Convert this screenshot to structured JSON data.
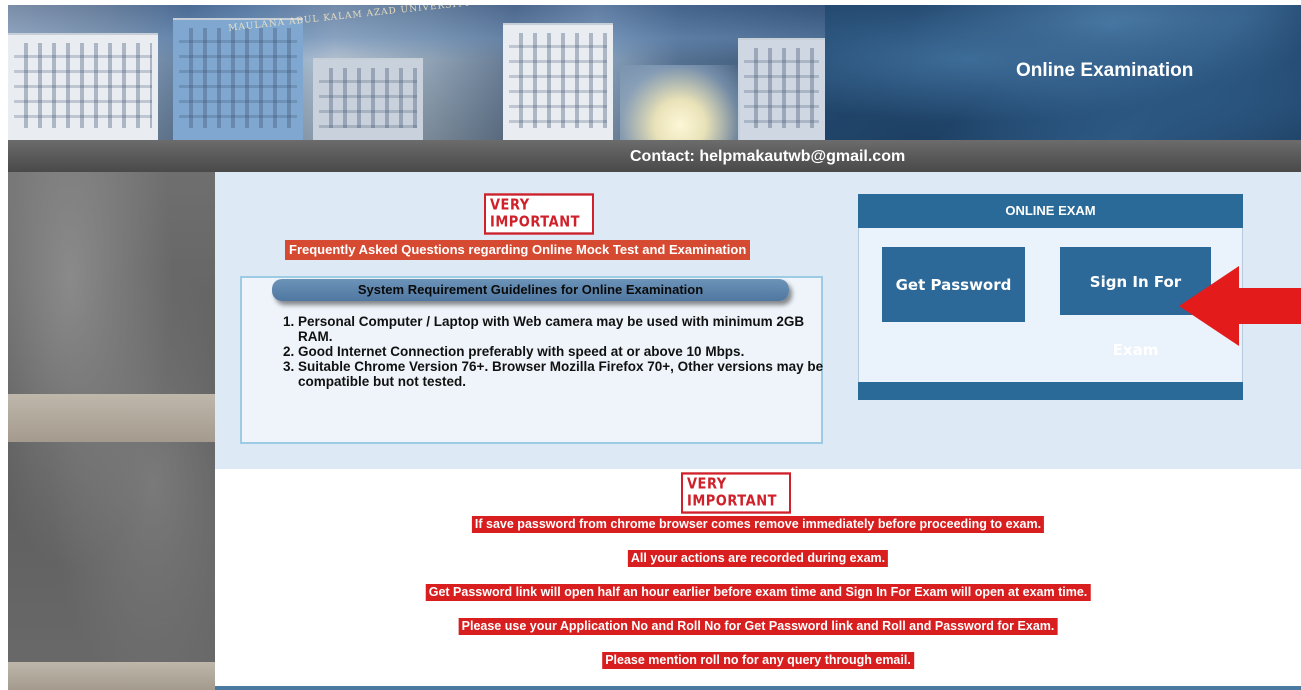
{
  "header": {
    "title": "Online Examination",
    "arch_text": "MAULANA ABUL KALAM AZAD UNIVERSITY OF TECHNOLOGY"
  },
  "contact": {
    "text": "Contact: helpmakautwb@gmail.com"
  },
  "top_section": {
    "badge": "VERY IMPORTANT",
    "faq_link": "Frequently Asked Questions regarding Online Mock Test and Examination",
    "guidelines": {
      "heading": "System Requirement Guidelines for Online Examination",
      "items": [
        "Personal Computer / Laptop with Web camera may be used with minimum 2GB RAM.",
        "Good Internet Connection preferably with speed at or above 10 Mbps.",
        "Suitable Chrome Version 76+. Browser Mozilla Firefox 70+, Other versions may be compatible but not tested."
      ]
    }
  },
  "exam_panel": {
    "heading": "ONLINE EXAM",
    "get_password": "Get Password",
    "sign_in": "Sign In For Exam"
  },
  "bottom_section": {
    "badge": "VERY IMPORTANT",
    "notices": [
      "If save password from chrome browser comes remove immediately before proceeding to exam.",
      "All your actions are recorded during exam.",
      "Get Password link will open half an hour earlier before exam time and Sign In For Exam will open at exam time.",
      "Please use your Application No and Roll No for Get Password link and Roll and Password for Exam.",
      "Please mention roll no for any query through email."
    ]
  },
  "colors": {
    "accent_blue": "#2c6898",
    "notice_red": "#d81e1e",
    "panel_bg": "#dde9f5"
  }
}
